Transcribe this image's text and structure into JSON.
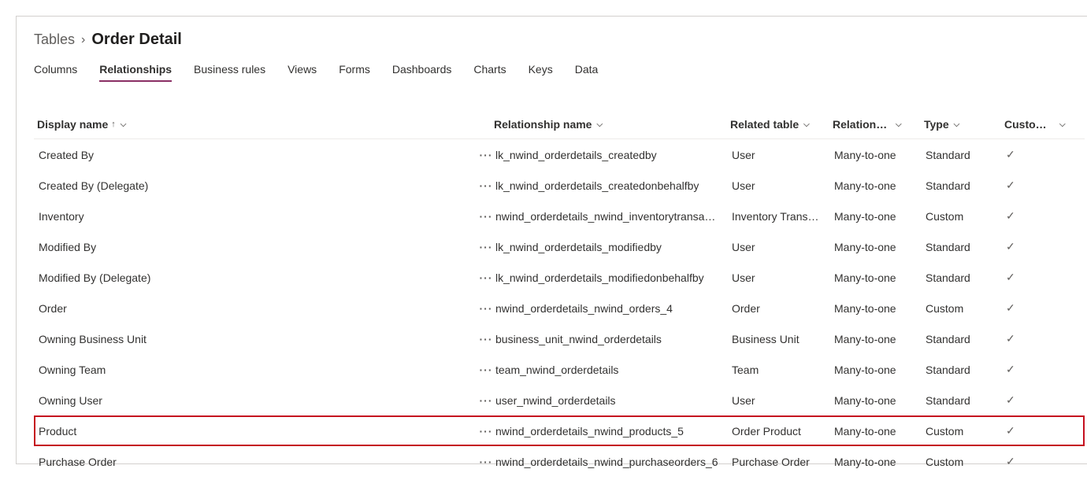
{
  "breadcrumb": {
    "parent": "Tables",
    "current": "Order Detail"
  },
  "tabs": [
    {
      "label": "Columns",
      "active": false
    },
    {
      "label": "Relationships",
      "active": true
    },
    {
      "label": "Business rules",
      "active": false
    },
    {
      "label": "Views",
      "active": false
    },
    {
      "label": "Forms",
      "active": false
    },
    {
      "label": "Dashboards",
      "active": false
    },
    {
      "label": "Charts",
      "active": false
    },
    {
      "label": "Keys",
      "active": false
    },
    {
      "label": "Data",
      "active": false
    }
  ],
  "headers": {
    "display_name": "Display name",
    "relationship_name": "Relationship name",
    "related_table": "Related table",
    "relationship_type": "Relationshi…",
    "type": "Type",
    "customizable": "Custom…"
  },
  "rows": [
    {
      "display_name": "Created By",
      "relationship_name": "lk_nwind_orderdetails_createdby",
      "related_table": "User",
      "relationship_type": "Many-to-one",
      "type": "Standard",
      "customizable": true,
      "highlighted": false
    },
    {
      "display_name": "Created By (Delegate)",
      "relationship_name": "lk_nwind_orderdetails_createdonbehalfby",
      "related_table": "User",
      "relationship_type": "Many-to-one",
      "type": "Standard",
      "customizable": true,
      "highlighted": false
    },
    {
      "display_name": "Inventory",
      "relationship_name": "nwind_orderdetails_nwind_inventorytransa…",
      "related_table": "Inventory Trans…",
      "relationship_type": "Many-to-one",
      "type": "Custom",
      "customizable": true,
      "highlighted": false
    },
    {
      "display_name": "Modified By",
      "relationship_name": "lk_nwind_orderdetails_modifiedby",
      "related_table": "User",
      "relationship_type": "Many-to-one",
      "type": "Standard",
      "customizable": true,
      "highlighted": false
    },
    {
      "display_name": "Modified By (Delegate)",
      "relationship_name": "lk_nwind_orderdetails_modifiedonbehalfby",
      "related_table": "User",
      "relationship_type": "Many-to-one",
      "type": "Standard",
      "customizable": true,
      "highlighted": false
    },
    {
      "display_name": "Order",
      "relationship_name": "nwind_orderdetails_nwind_orders_4",
      "related_table": "Order",
      "relationship_type": "Many-to-one",
      "type": "Custom",
      "customizable": true,
      "highlighted": false
    },
    {
      "display_name": "Owning Business Unit",
      "relationship_name": "business_unit_nwind_orderdetails",
      "related_table": "Business Unit",
      "relationship_type": "Many-to-one",
      "type": "Standard",
      "customizable": true,
      "highlighted": false
    },
    {
      "display_name": "Owning Team",
      "relationship_name": "team_nwind_orderdetails",
      "related_table": "Team",
      "relationship_type": "Many-to-one",
      "type": "Standard",
      "customizable": true,
      "highlighted": false
    },
    {
      "display_name": "Owning User",
      "relationship_name": "user_nwind_orderdetails",
      "related_table": "User",
      "relationship_type": "Many-to-one",
      "type": "Standard",
      "customizable": true,
      "highlighted": false
    },
    {
      "display_name": "Product",
      "relationship_name": "nwind_orderdetails_nwind_products_5",
      "related_table": "Order Product",
      "relationship_type": "Many-to-one",
      "type": "Custom",
      "customizable": true,
      "highlighted": true
    },
    {
      "display_name": "Purchase Order",
      "relationship_name": "nwind_orderdetails_nwind_purchaseorders_6",
      "related_table": "Purchase Order",
      "relationship_type": "Many-to-one",
      "type": "Custom",
      "customizable": true,
      "highlighted": false
    }
  ]
}
